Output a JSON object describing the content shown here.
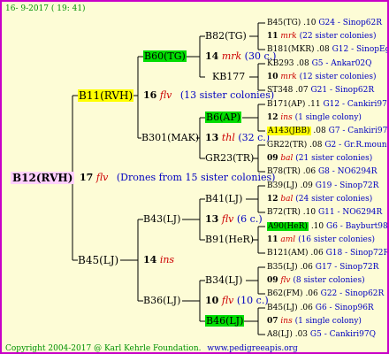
{
  "header": {
    "date": "16- 9-2017 ( 19: 41)"
  },
  "footer": {
    "copyright": "Copyright 2004-2017 @ Karl Kehrle Foundation.",
    "website": "www.pedigreeapis.org"
  },
  "root": {
    "label": "B12(RVH)",
    "sire": {
      "num": "17",
      "bee": "flv",
      "note": "(Drones from 15 sister colonies)"
    }
  },
  "g1_top": {
    "label": "B11(RVH)",
    "num": "16",
    "bee": "flv",
    "note": "(13 sister colonies)"
  },
  "g1_bot": {
    "label": "B45(LJ)",
    "num": "14",
    "bee": "ins"
  },
  "g2": [
    {
      "label": "B60(TG)"
    },
    {
      "label": "B301(MAK)",
      "num": "13",
      "bee": "thl",
      "note": "(32 c.)"
    },
    {
      "label": "B43(LJ)",
      "num": "13",
      "bee": "flv",
      "note": "(6 c.)"
    },
    {
      "label": "B36(LJ)",
      "num": "10",
      "bee": "flv",
      "note": "(10 c.)"
    }
  ],
  "g2_extra": {
    "b60_num": "14",
    "b60_bee": "mrk",
    "b60_note": "(30 c.)"
  },
  "g3": [
    {
      "label": "B82(TG)"
    },
    {
      "label": "KB177"
    },
    {
      "label": "B6(AP)"
    },
    {
      "label": "GR23(TR)"
    },
    {
      "label": "B41(LJ)"
    },
    {
      "label": "B91(HeR)"
    },
    {
      "label": "B34(LJ)"
    },
    {
      "label": "B46(LJ)"
    }
  ],
  "g4": [
    {
      "a": "B45(TG)",
      "b": ".10",
      "c": "G24 - Sinop62R"
    },
    {
      "num": "11",
      "bee": "mrk",
      "note": "(22 sister colonies)"
    },
    {
      "a": "B181(MKR)",
      "b": ".08",
      "c": "G12 - SinopEgg86R"
    },
    {
      "a": "KB293",
      "b": ".08",
      "c": "G5 - Ankar02Q"
    },
    {
      "num": "10",
      "bee": "mrk",
      "note": "(12 sister colonies)"
    },
    {
      "a": "ST348",
      "b": ".07",
      "c": "G21 - Sinop62R"
    },
    {
      "a": "B171(AP)",
      "b": ".11",
      "c": "G12 - Cankiri97Q"
    },
    {
      "num": "12",
      "bee": "ins",
      "note": "(1 single colony)"
    },
    {
      "a": "A143(JBB)",
      "b": ".08",
      "c": "G7 - Cankiri97Q"
    },
    {
      "a": "GR22(TR)",
      "b": ".08",
      "c": "G2 - Gr.R.mounta"
    },
    {
      "num": "09",
      "bee": "bal",
      "note": "(21 sister colonies)"
    },
    {
      "a": "B78(TR)",
      "b": ".06",
      "c": "G8 - NO6294R"
    },
    {
      "a": "B39(LJ)",
      "b": ".09",
      "c": "G19 - Sinop72R"
    },
    {
      "num": "12",
      "bee": "bal",
      "note": "(24 sister colonies)"
    },
    {
      "a": "B72(TR)",
      "b": ".10",
      "c": "G11 - NO6294R"
    },
    {
      "a": "A90(HeR)",
      "b": ".10",
      "c": "G6 - Bayburt98-3"
    },
    {
      "num": "11",
      "bee": "aml",
      "note": "(16 sister colonies)"
    },
    {
      "a": "B121(AM)",
      "b": ".06",
      "c": "G18 - Sinop72R"
    },
    {
      "a": "B35(LJ)",
      "b": ".06",
      "c": "G17 - Sinop72R"
    },
    {
      "num": "09",
      "bee": "flv",
      "note": "(8 sister colonies)"
    },
    {
      "a": "B62(FM)",
      "b": ".06",
      "c": "G22 - Sinop62R"
    },
    {
      "a": "B45(LJ)",
      "b": ".06",
      "c": "G6 - Sinop96R"
    },
    {
      "num": "07",
      "bee": "ins",
      "note": "(1 single colony)"
    },
    {
      "a": "A8(LJ)",
      "b": ".03",
      "c": "G5 - Cankiri97Q"
    }
  ]
}
